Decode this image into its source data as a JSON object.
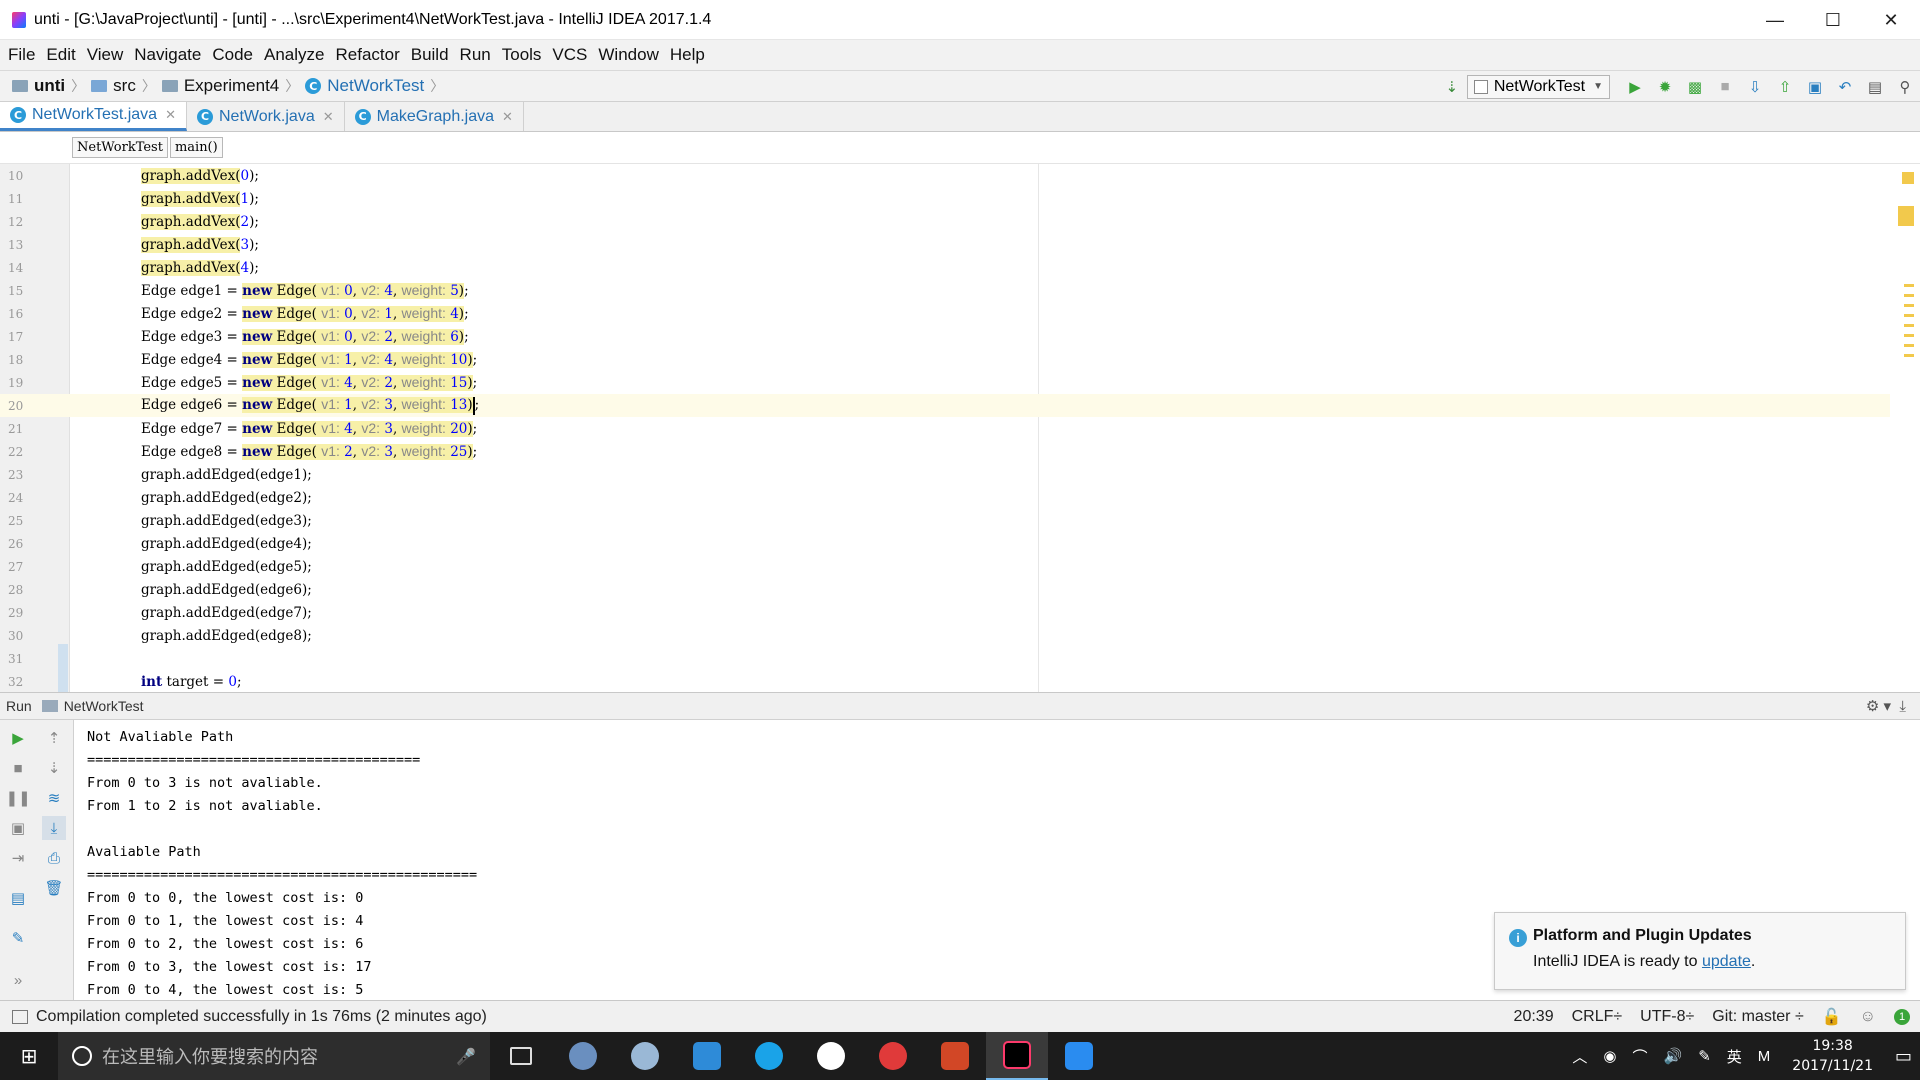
{
  "window": {
    "title": "unti - [G:\\JavaProject\\unti] - [unti] - ...\\src\\Experiment4\\NetWorkTest.java - IntelliJ IDEA 2017.1.4",
    "minimize": "—",
    "maximize": "☐",
    "close": "✕"
  },
  "menu": [
    "File",
    "Edit",
    "View",
    "Navigate",
    "Code",
    "Analyze",
    "Refactor",
    "Build",
    "Run",
    "Tools",
    "VCS",
    "Window",
    "Help"
  ],
  "breadcrumb": [
    "unti",
    "src",
    "Experiment4",
    "NetWorkTest"
  ],
  "run_config": "NetWorkTest",
  "tabs": [
    "NetWorkTest.java",
    "NetWork.java",
    "MakeGraph.java"
  ],
  "editor_crumbs": [
    "NetWorkTest",
    "main()"
  ],
  "editor": {
    "line_numbers": [
      "10",
      "11",
      "12",
      "13",
      "14",
      "15",
      "16",
      "17",
      "18",
      "19",
      "20",
      "21",
      "22",
      "23",
      "24",
      "25",
      "26",
      "27",
      "28",
      "29",
      "30",
      "31",
      "32"
    ],
    "vex_lines": [
      {
        "pre": "graph.addVex(",
        "arg": "0",
        "post": ");"
      },
      {
        "pre": "graph.addVex(",
        "arg": "1",
        "post": ");"
      },
      {
        "pre": "graph.addVex(",
        "arg": "2",
        "post": ");"
      },
      {
        "pre": "graph.addVex(",
        "arg": "3",
        "post": ");"
      },
      {
        "pre": "graph.addVex(",
        "arg": "4",
        "post": ");"
      }
    ],
    "edge_lines": [
      {
        "decl": "Edge edge1 = ",
        "kw": "new",
        "ctor": " Edge(",
        "v1": "0",
        "v2": "4",
        "w": "5"
      },
      {
        "decl": "Edge edge2 = ",
        "kw": "new",
        "ctor": " Edge(",
        "v1": "0",
        "v2": "1",
        "w": "4"
      },
      {
        "decl": "Edge edge3 = ",
        "kw": "new",
        "ctor": " Edge(",
        "v1": "0",
        "v2": "2",
        "w": "6"
      },
      {
        "decl": "Edge edge4 = ",
        "kw": "new",
        "ctor": " Edge(",
        "v1": "1",
        "v2": "4",
        "w": "10"
      },
      {
        "decl": "Edge edge5 = ",
        "kw": "new",
        "ctor": " Edge(",
        "v1": "4",
        "v2": "2",
        "w": "15"
      },
      {
        "decl": "Edge edge6 = ",
        "kw": "new",
        "ctor": " Edge(",
        "v1": "1",
        "v2": "3",
        "w": "13"
      },
      {
        "decl": "Edge edge7 = ",
        "kw": "new",
        "ctor": " Edge(",
        "v1": "4",
        "v2": "3",
        "w": "20"
      },
      {
        "decl": "Edge edge8 = ",
        "kw": "new",
        "ctor": " Edge(",
        "v1": "2",
        "v2": "3",
        "w": "25"
      }
    ],
    "hint_v1": "v1:",
    "hint_v2": "v2:",
    "hint_weight": "weight:",
    "added_lines": [
      "graph.addEdged(edge1);",
      "graph.addEdged(edge2);",
      "graph.addEdged(edge3);",
      "graph.addEdged(edge4);",
      "graph.addEdged(edge5);",
      "graph.addEdged(edge6);",
      "graph.addEdged(edge7);",
      "graph.addEdged(edge8);"
    ],
    "last_line": {
      "kw": "int",
      "rest": " target = ",
      "num": "0",
      "end": ";"
    }
  },
  "run_panel": {
    "label": "Run",
    "config": "NetWorkTest",
    "output": [
      "Not Avaliable Path",
      "=========================================",
      "From 0 to 3 is not avaliable.",
      "From 1 to 2 is not avaliable.",
      "",
      "Avaliable Path",
      "================================================",
      "From 0 to 0, the lowest cost is: 0",
      "From 0 to 1, the lowest cost is: 4",
      "From 0 to 2, the lowest cost is: 6",
      "From 0 to 3, the lowest cost is: 17",
      "From 0 to 4, the lowest cost is: 5"
    ]
  },
  "notification": {
    "title": "Platform and Plugin Updates",
    "body_prefix": "IntelliJ IDEA is ready to ",
    "link": "update",
    "body_suffix": "."
  },
  "status": {
    "message": "Compilation completed successfully in 1s 76ms (2 minutes ago)",
    "position": "20:39",
    "line_sep": "CRLF÷",
    "encoding": "UTF-8÷",
    "git": "Git: master ÷",
    "badge": "1"
  },
  "taskbar": {
    "search_placeholder": "在这里输入你要搜索的内容",
    "ime": "英",
    "time": "19:38",
    "date": "2017/11/21"
  },
  "colors": {
    "accent": "#4083c9",
    "highlight": "#f7f0a8",
    "current_line": "#fefbe8"
  }
}
